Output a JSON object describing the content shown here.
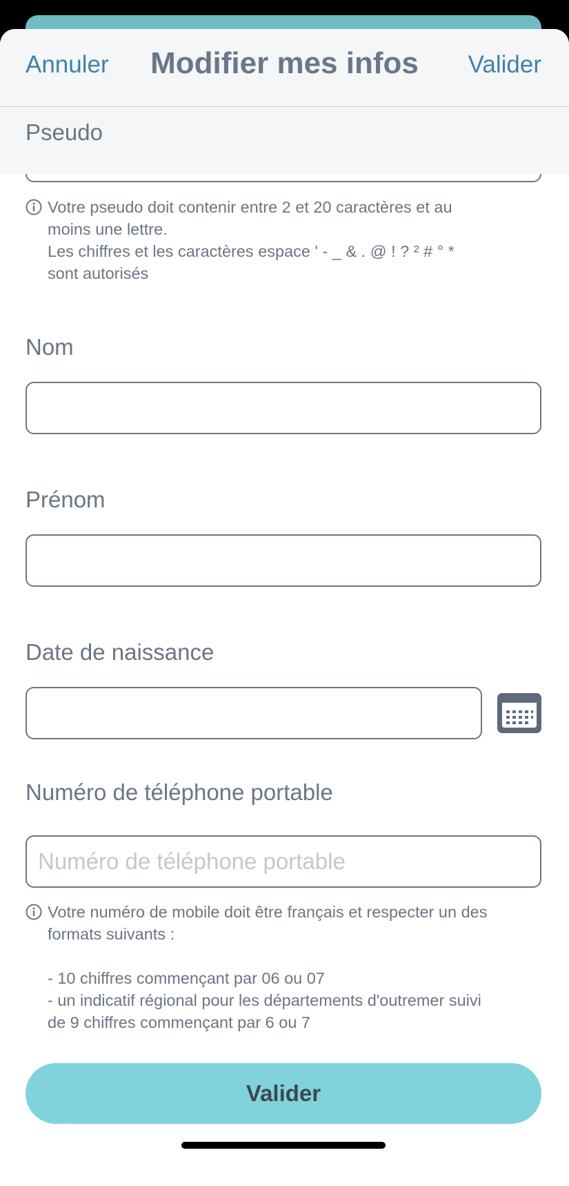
{
  "header": {
    "cancel_label": "Annuler",
    "title": "Modifier mes infos",
    "confirm_label": "Valider"
  },
  "pseudo": {
    "label": "Pseudo",
    "info_lines": [
      "Votre pseudo doit contenir entre 2 et 20 caractères et au",
      "moins une lettre.",
      "Les chiffres et les caractères espace ' - _ & . @ ! ? ² # ° *",
      "sont autorisés"
    ]
  },
  "nom": {
    "label": "Nom"
  },
  "prenom": {
    "label": "Prénom"
  },
  "birthdate": {
    "label": "Date de naissance",
    "calendar_icon": "calendar-icon"
  },
  "phone": {
    "label": "Numéro de téléphone portable",
    "placeholder": "Numéro de téléphone portable",
    "info_lines": [
      "Votre numéro de mobile doit être français et respecter un des",
      "formats suivants :",
      "",
      "- 10 chiffres commençant par 06 ou 07",
      "- un indicatif régional pour les départements d'outremer suivi",
      "de 9 chiffres commençant par 6 ou 7"
    ]
  },
  "submit_label": "Valider",
  "colors": {
    "accent_link": "#3d83a8",
    "button_bg": "#81d3db",
    "top_card": "#6fbcc4",
    "text_gray": "#6b7583",
    "field_border": "#6b7586"
  },
  "icons": {
    "info": "info-icon",
    "calendar": "calendar-icon"
  }
}
